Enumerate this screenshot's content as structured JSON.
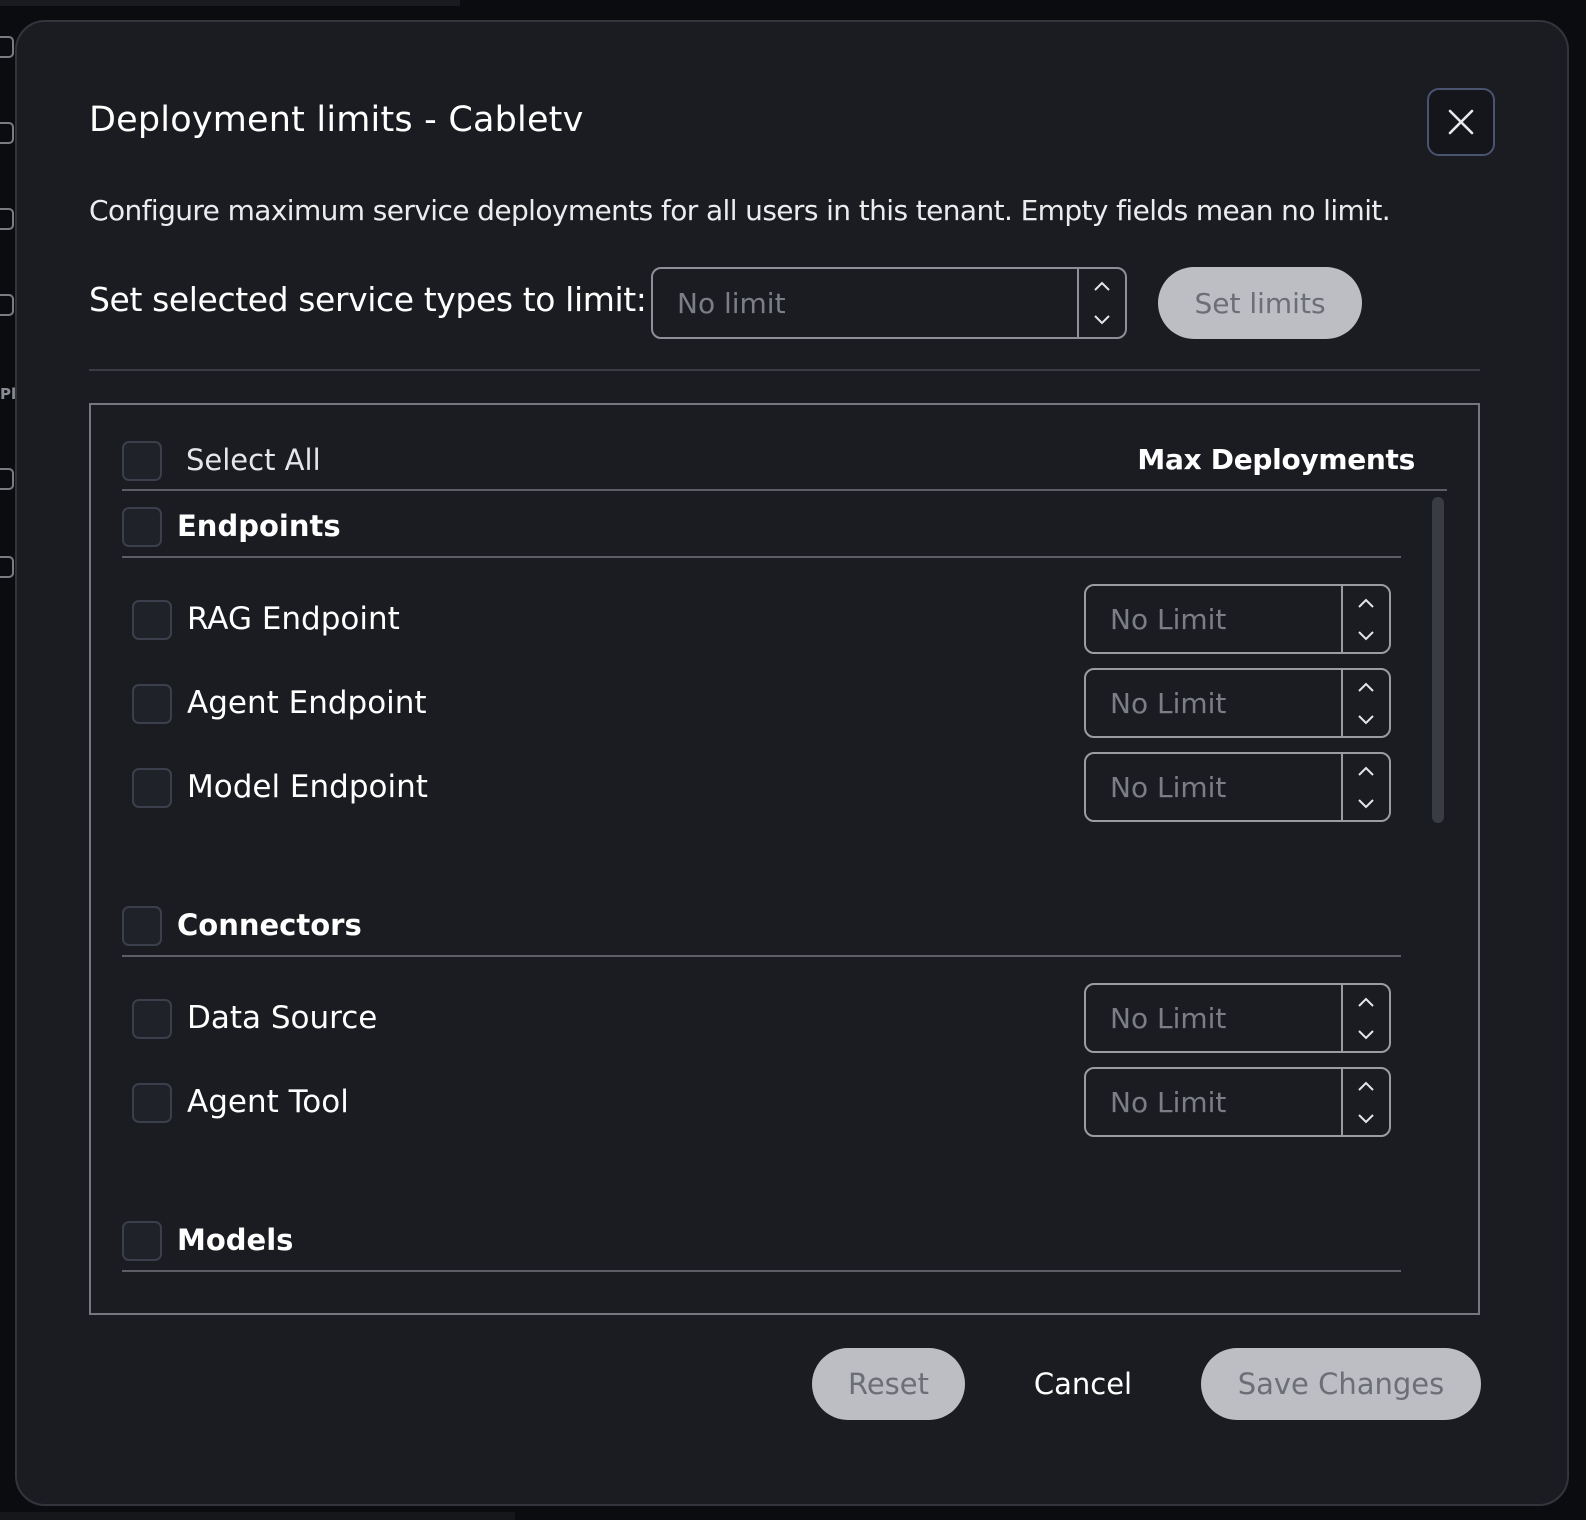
{
  "background": {
    "sidebar_partial_text": "Pl"
  },
  "modal": {
    "title": "Deployment limits - Cabletv",
    "description": "Configure maximum service deployments for all users in this tenant. Empty fields mean no limit.",
    "close_icon": "close-icon"
  },
  "bulk": {
    "label": "Set selected service types to limit:",
    "placeholder": "No limit",
    "button_label": "Set limits"
  },
  "table": {
    "select_all_label": "Select All",
    "max_header": "Max Deployments",
    "groups": [
      {
        "label": "Endpoints",
        "items": [
          {
            "label": "RAG Endpoint",
            "placeholder": "No Limit"
          },
          {
            "label": "Agent Endpoint",
            "placeholder": "No Limit"
          },
          {
            "label": "Model Endpoint",
            "placeholder": "No Limit"
          }
        ]
      },
      {
        "label": "Connectors",
        "items": [
          {
            "label": "Data Source",
            "placeholder": "No Limit"
          },
          {
            "label": "Agent Tool",
            "placeholder": "No Limit"
          }
        ]
      },
      {
        "label": "Models",
        "items": []
      }
    ]
  },
  "footer": {
    "reset_label": "Reset",
    "cancel_label": "Cancel",
    "save_label": "Save Changes"
  },
  "colors": {
    "modal_bg": "#1b1c21",
    "disabled_button_bg": "#bdbec3",
    "disabled_button_text": "#6d6f76",
    "checkbox_bg": "#1f2229"
  }
}
